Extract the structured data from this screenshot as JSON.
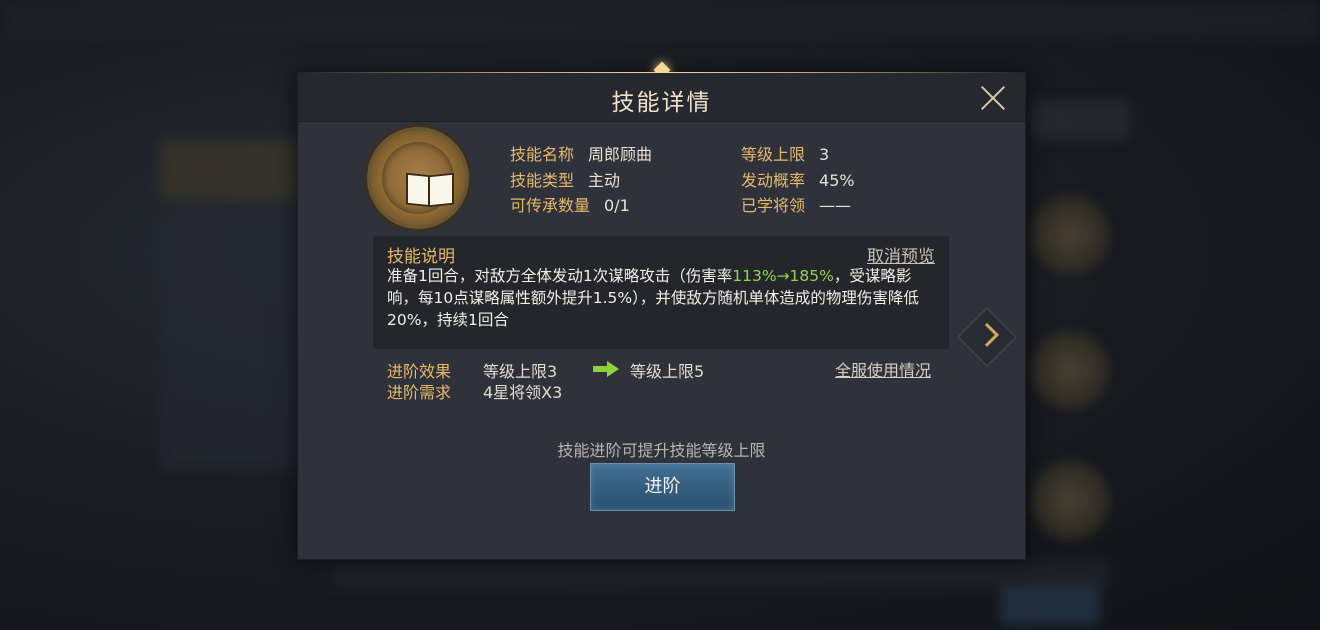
{
  "dialog": {
    "title": "技能详情",
    "icon": "book-icon"
  },
  "info": {
    "name_label": "技能名称",
    "name_value": "周郎顾曲",
    "type_label": "技能类型",
    "type_value": "主动",
    "inherit_label": "可传承数量",
    "inherit_value": "0/1",
    "level_cap_label": "等级上限",
    "level_cap_value": "3",
    "trigger_label": "发动概率",
    "trigger_value": "45%",
    "learned_label": "已学将领",
    "learned_value": "——"
  },
  "description": {
    "heading": "技能说明",
    "cancel_preview": "取消预览",
    "text_before": "准备1回合，对敌方全体发动1次谋略攻击（伤害率",
    "highlight": "113%→185%",
    "text_after": "，受谋略影响，每10点谋略属性额外提升1.5%），并使敌方随机单体造成的物理伤害降低20%，持续1回合"
  },
  "advance": {
    "effect_label": "进阶效果",
    "effect_from": "等级上限3",
    "effect_to": "等级上限5",
    "require_label": "进阶需求",
    "require_value": "4星将领X3",
    "server_usage_link": "全服使用情况",
    "hint": "技能进阶可提升技能等级上限",
    "button": "进阶"
  },
  "colors": {
    "accent_gold": "#e6b96a",
    "highlight_green": "#8fd64a",
    "button_blue": "#2b4f6d"
  }
}
